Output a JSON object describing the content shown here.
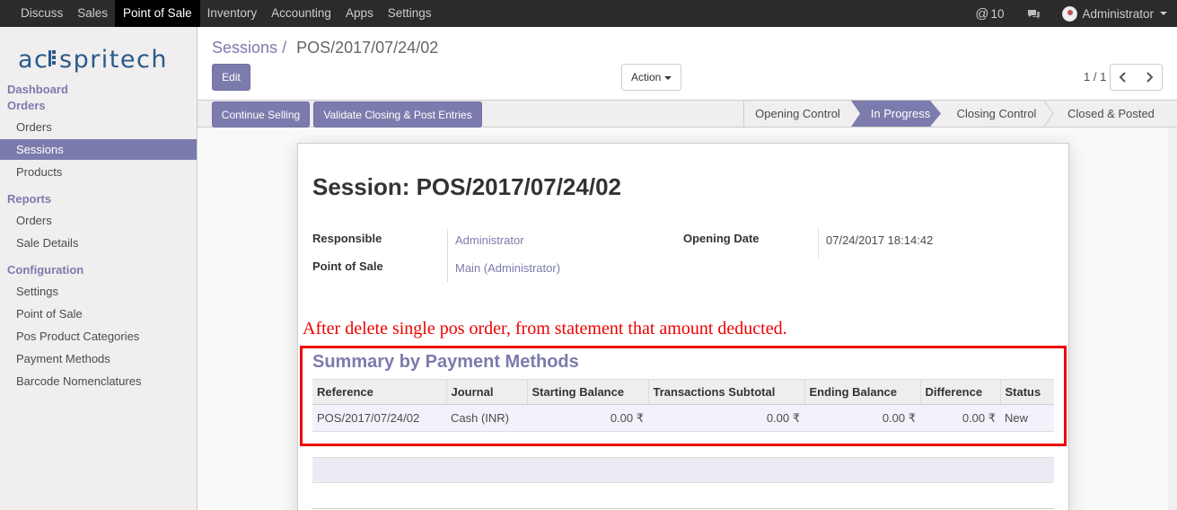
{
  "topbar": {
    "menu": [
      "Discuss",
      "Sales",
      "Point of Sale",
      "Inventory",
      "Accounting",
      "Apps",
      "Settings"
    ],
    "active_menu": "Point of Sale",
    "notification_count": "10",
    "user": "Administrator"
  },
  "logo": {
    "text": "acespritech"
  },
  "sidebar": {
    "dashboard": "Dashboard",
    "orders_head": "Orders",
    "orders_items": [
      "Orders",
      "Sessions",
      "Products"
    ],
    "active_item": "Sessions",
    "reports_head": "Reports",
    "reports_items": [
      "Orders",
      "Sale Details"
    ],
    "config_head": "Configuration",
    "config_items": [
      "Settings",
      "Point of Sale",
      "Pos Product Categories",
      "Payment Methods",
      "Barcode Nomenclatures"
    ]
  },
  "control": {
    "breadcrumb_parent": "Sessions",
    "breadcrumb_sep": "/",
    "breadcrumb_current": "POS/2017/07/24/02",
    "edit_label": "Edit",
    "action_label": "Action",
    "pager": "1 / 1"
  },
  "statusbar": {
    "buttons": [
      "Continue Selling",
      "Validate Closing & Post Entries"
    ],
    "stages": [
      "Opening Control",
      "In Progress",
      "Closing Control",
      "Closed & Posted"
    ],
    "active_stage": "In Progress"
  },
  "form": {
    "title": "Session: POS/2017/07/24/02",
    "responsible_label": "Responsible",
    "responsible_value": "Administrator",
    "pos_label": "Point of Sale",
    "pos_value": "Main (Administrator)",
    "opening_date_label": "Opening Date",
    "opening_date_value": "07/24/2017 18:14:42"
  },
  "annotation": "After delete single pos order, from statement that amount deducted.",
  "summary": {
    "title": "Summary by Payment Methods",
    "columns": [
      "Reference",
      "Journal",
      "Starting Balance",
      "Transactions Subtotal",
      "Ending Balance",
      "Difference",
      "Status"
    ],
    "rows": [
      [
        "POS/2017/07/24/02",
        "Cash (INR)",
        "0.00 ₹",
        "0.00 ₹",
        "0.00 ₹",
        "0.00 ₹",
        "New"
      ]
    ]
  },
  "colors": {
    "accent": "#7c7bad",
    "topbar": "#2b2b2b",
    "annotation_red": "#e00000"
  },
  "icons": [
    "at-icon",
    "chat-icon",
    "avatar",
    "caret-down-icon",
    "chevron-left-icon",
    "chevron-right-icon"
  ]
}
